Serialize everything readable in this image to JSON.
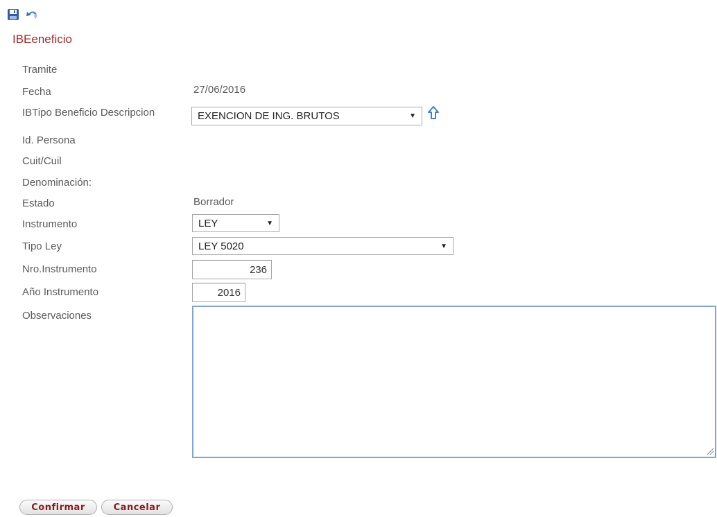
{
  "toolbar": {
    "save_icon": "save-icon",
    "undo_icon": "undo-icon"
  },
  "form": {
    "title": "IBEeneficio",
    "fields": {
      "tramite": {
        "label": "Tramite",
        "value": ""
      },
      "fecha": {
        "label": "Fecha",
        "value": "27/06/2016"
      },
      "tipo_beneficio": {
        "label": "IBTipo Beneficio Descripcion",
        "selected": "EXENCION DE ING. BRUTOS"
      },
      "id_persona": {
        "label": "Id. Persona",
        "value": ""
      },
      "cuit_cuil": {
        "label": "Cuit/Cuil",
        "value": ""
      },
      "denominacion": {
        "label": "Denominación:",
        "value": ""
      },
      "estado": {
        "label": "Estado",
        "value": "Borrador"
      },
      "instrumento": {
        "label": "Instrumento",
        "selected": "LEY"
      },
      "tipo_ley": {
        "label": "Tipo Ley",
        "selected": "LEY 5020"
      },
      "nro_instrumento": {
        "label": "Nro.Instrumento",
        "value": "236"
      },
      "anio_instrumento": {
        "label": "Año Instrumento",
        "value": "2016"
      },
      "observaciones": {
        "label": "Observaciones",
        "value": ""
      }
    }
  },
  "buttons": {
    "confirm_label": "Confirmar",
    "cancel_label": "Cancelar"
  },
  "colors": {
    "title": "#a52a2a",
    "button_text": "#8b1a1a",
    "focus_border": "#7ea4d8",
    "icon_blue": "#2f6db5"
  }
}
